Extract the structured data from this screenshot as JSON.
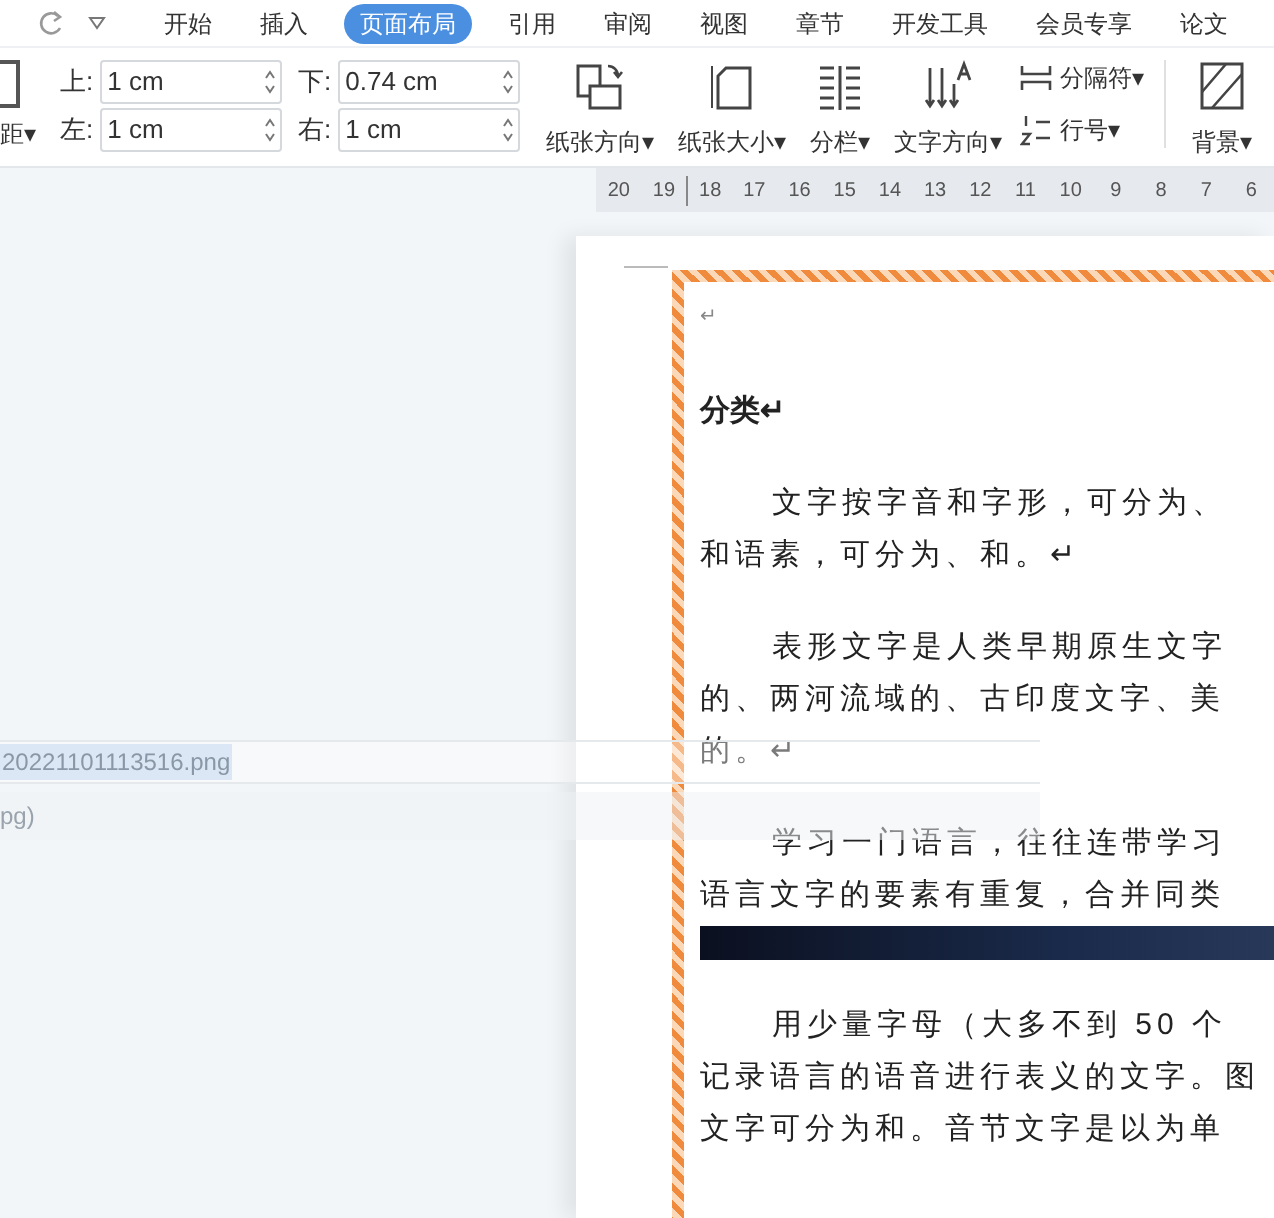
{
  "tabs": [
    {
      "label": "开始",
      "selected": false
    },
    {
      "label": "插入",
      "selected": false
    },
    {
      "label": "页面布局",
      "selected": true
    },
    {
      "label": "引用",
      "selected": false
    },
    {
      "label": "审阅",
      "selected": false
    },
    {
      "label": "视图",
      "selected": false
    },
    {
      "label": "章节",
      "selected": false
    },
    {
      "label": "开发工具",
      "selected": false
    },
    {
      "label": "会员专享",
      "selected": false
    },
    {
      "label": "论文",
      "selected": false
    }
  ],
  "ribbon": {
    "margins_label": "距▾",
    "margins": [
      {
        "label": "上:",
        "value": "1 cm"
      },
      {
        "label": "左:",
        "value": "1 cm"
      },
      {
        "label": "下:",
        "value": "0.74 cm"
      },
      {
        "label": "右:",
        "value": "1 cm"
      }
    ],
    "buttons": [
      {
        "kind": "large",
        "label": "纸张方向▾"
      },
      {
        "kind": "large",
        "label": "纸张大小▾"
      },
      {
        "kind": "large",
        "label": "分栏▾"
      },
      {
        "kind": "large",
        "label": "文字方向▾"
      },
      {
        "kind": "small",
        "label": "分隔符▾"
      },
      {
        "kind": "small",
        "label": "行号▾"
      },
      {
        "kind": "large",
        "label": "背景▾"
      }
    ]
  },
  "ruler": {
    "ticks": [
      "20",
      "19",
      "18",
      "17",
      "16",
      "15",
      "14",
      "13",
      "12",
      "11",
      "10",
      "9",
      "8",
      "7",
      "6"
    ]
  },
  "document": {
    "lines": [
      {
        "kind": "mark",
        "text": "↵"
      },
      {
        "kind": "heading",
        "text": "分类↵"
      },
      {
        "kind": "para",
        "text": "文字按字音和字形，可分为、",
        "indent": true
      },
      {
        "kind": "para",
        "text": "和语素，可分为、和。↵",
        "indent": false
      },
      {
        "kind": "blank"
      },
      {
        "kind": "para",
        "text": "表形文字是人类早期原生文字",
        "indent": true
      },
      {
        "kind": "para",
        "text": "的、两河流域的、古印度文字、美",
        "indent": false
      },
      {
        "kind": "para",
        "text": "的。↵",
        "indent": false
      },
      {
        "kind": "blank"
      },
      {
        "kind": "para",
        "text": "学习一门语言，往往连带学习",
        "indent": true
      },
      {
        "kind": "para",
        "text": "语言文字的要素有重复，合并同类",
        "indent": false
      },
      {
        "kind": "image"
      },
      {
        "kind": "blank"
      },
      {
        "kind": "para",
        "text": "用少量字母（大多不到 50 个",
        "indent": true
      },
      {
        "kind": "para",
        "text": "记录语言的语音进行表义的文字。图",
        "indent": false
      },
      {
        "kind": "para",
        "text": "文字可分为和。音节文字是以为单",
        "indent": false
      }
    ]
  },
  "overlay": {
    "file_name": "20221101113516.png",
    "file_type": "pg)"
  }
}
